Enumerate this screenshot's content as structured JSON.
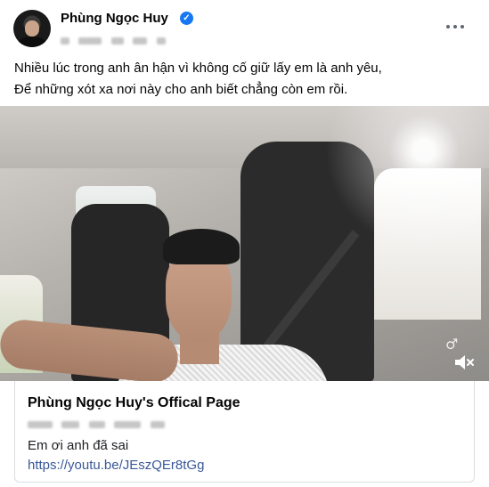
{
  "post": {
    "author": {
      "name": "Phùng Ngọc Huy",
      "verified_icon": "verified-badge-icon",
      "avatar_icon": "profile-avatar"
    },
    "more_icon": "more-options-icon",
    "caption": {
      "line1": "Nhiều lúc trong anh ân hận vì không cố giữ lấy em là anh yêu,",
      "line2": "Để những xót xa nơi này cho anh biết chẳng còn em rồi."
    },
    "video": {
      "watermark": "♂",
      "mute_icon": "volume-muted-icon"
    },
    "link_preview": {
      "title": "Phùng Ngọc Huy's Offical Page",
      "description": "Em ơi anh đã sai",
      "url": "https://youtu.be/JEszQEr8tGg"
    }
  },
  "colors": {
    "link_blue": "#385898",
    "verified_blue": "#1877f2",
    "text_primary": "#050505",
    "border": "#dadde1"
  }
}
